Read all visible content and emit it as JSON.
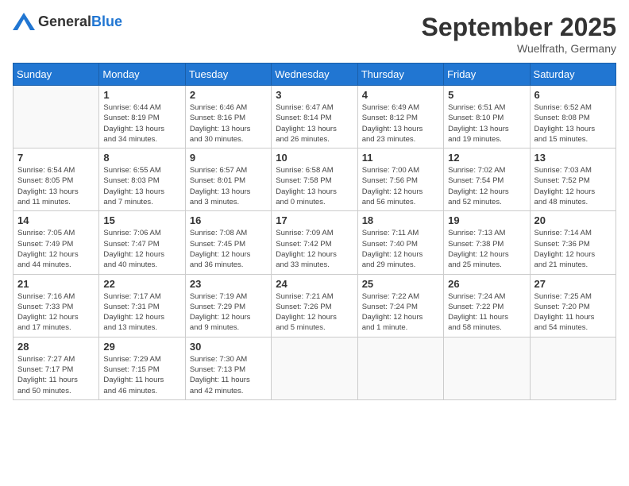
{
  "logo": {
    "general": "General",
    "blue": "Blue"
  },
  "title": "September 2025",
  "subtitle": "Wuelfrath, Germany",
  "days_of_week": [
    "Sunday",
    "Monday",
    "Tuesday",
    "Wednesday",
    "Thursday",
    "Friday",
    "Saturday"
  ],
  "weeks": [
    [
      {
        "day": "",
        "info": ""
      },
      {
        "day": "1",
        "info": "Sunrise: 6:44 AM\nSunset: 8:19 PM\nDaylight: 13 hours\nand 34 minutes."
      },
      {
        "day": "2",
        "info": "Sunrise: 6:46 AM\nSunset: 8:16 PM\nDaylight: 13 hours\nand 30 minutes."
      },
      {
        "day": "3",
        "info": "Sunrise: 6:47 AM\nSunset: 8:14 PM\nDaylight: 13 hours\nand 26 minutes."
      },
      {
        "day": "4",
        "info": "Sunrise: 6:49 AM\nSunset: 8:12 PM\nDaylight: 13 hours\nand 23 minutes."
      },
      {
        "day": "5",
        "info": "Sunrise: 6:51 AM\nSunset: 8:10 PM\nDaylight: 13 hours\nand 19 minutes."
      },
      {
        "day": "6",
        "info": "Sunrise: 6:52 AM\nSunset: 8:08 PM\nDaylight: 13 hours\nand 15 minutes."
      }
    ],
    [
      {
        "day": "7",
        "info": "Sunrise: 6:54 AM\nSunset: 8:05 PM\nDaylight: 13 hours\nand 11 minutes."
      },
      {
        "day": "8",
        "info": "Sunrise: 6:55 AM\nSunset: 8:03 PM\nDaylight: 13 hours\nand 7 minutes."
      },
      {
        "day": "9",
        "info": "Sunrise: 6:57 AM\nSunset: 8:01 PM\nDaylight: 13 hours\nand 3 minutes."
      },
      {
        "day": "10",
        "info": "Sunrise: 6:58 AM\nSunset: 7:58 PM\nDaylight: 13 hours\nand 0 minutes."
      },
      {
        "day": "11",
        "info": "Sunrise: 7:00 AM\nSunset: 7:56 PM\nDaylight: 12 hours\nand 56 minutes."
      },
      {
        "day": "12",
        "info": "Sunrise: 7:02 AM\nSunset: 7:54 PM\nDaylight: 12 hours\nand 52 minutes."
      },
      {
        "day": "13",
        "info": "Sunrise: 7:03 AM\nSunset: 7:52 PM\nDaylight: 12 hours\nand 48 minutes."
      }
    ],
    [
      {
        "day": "14",
        "info": "Sunrise: 7:05 AM\nSunset: 7:49 PM\nDaylight: 12 hours\nand 44 minutes."
      },
      {
        "day": "15",
        "info": "Sunrise: 7:06 AM\nSunset: 7:47 PM\nDaylight: 12 hours\nand 40 minutes."
      },
      {
        "day": "16",
        "info": "Sunrise: 7:08 AM\nSunset: 7:45 PM\nDaylight: 12 hours\nand 36 minutes."
      },
      {
        "day": "17",
        "info": "Sunrise: 7:09 AM\nSunset: 7:42 PM\nDaylight: 12 hours\nand 33 minutes."
      },
      {
        "day": "18",
        "info": "Sunrise: 7:11 AM\nSunset: 7:40 PM\nDaylight: 12 hours\nand 29 minutes."
      },
      {
        "day": "19",
        "info": "Sunrise: 7:13 AM\nSunset: 7:38 PM\nDaylight: 12 hours\nand 25 minutes."
      },
      {
        "day": "20",
        "info": "Sunrise: 7:14 AM\nSunset: 7:36 PM\nDaylight: 12 hours\nand 21 minutes."
      }
    ],
    [
      {
        "day": "21",
        "info": "Sunrise: 7:16 AM\nSunset: 7:33 PM\nDaylight: 12 hours\nand 17 minutes."
      },
      {
        "day": "22",
        "info": "Sunrise: 7:17 AM\nSunset: 7:31 PM\nDaylight: 12 hours\nand 13 minutes."
      },
      {
        "day": "23",
        "info": "Sunrise: 7:19 AM\nSunset: 7:29 PM\nDaylight: 12 hours\nand 9 minutes."
      },
      {
        "day": "24",
        "info": "Sunrise: 7:21 AM\nSunset: 7:26 PM\nDaylight: 12 hours\nand 5 minutes."
      },
      {
        "day": "25",
        "info": "Sunrise: 7:22 AM\nSunset: 7:24 PM\nDaylight: 12 hours\nand 1 minute."
      },
      {
        "day": "26",
        "info": "Sunrise: 7:24 AM\nSunset: 7:22 PM\nDaylight: 11 hours\nand 58 minutes."
      },
      {
        "day": "27",
        "info": "Sunrise: 7:25 AM\nSunset: 7:20 PM\nDaylight: 11 hours\nand 54 minutes."
      }
    ],
    [
      {
        "day": "28",
        "info": "Sunrise: 7:27 AM\nSunset: 7:17 PM\nDaylight: 11 hours\nand 50 minutes."
      },
      {
        "day": "29",
        "info": "Sunrise: 7:29 AM\nSunset: 7:15 PM\nDaylight: 11 hours\nand 46 minutes."
      },
      {
        "day": "30",
        "info": "Sunrise: 7:30 AM\nSunset: 7:13 PM\nDaylight: 11 hours\nand 42 minutes."
      },
      {
        "day": "",
        "info": ""
      },
      {
        "day": "",
        "info": ""
      },
      {
        "day": "",
        "info": ""
      },
      {
        "day": "",
        "info": ""
      }
    ]
  ]
}
